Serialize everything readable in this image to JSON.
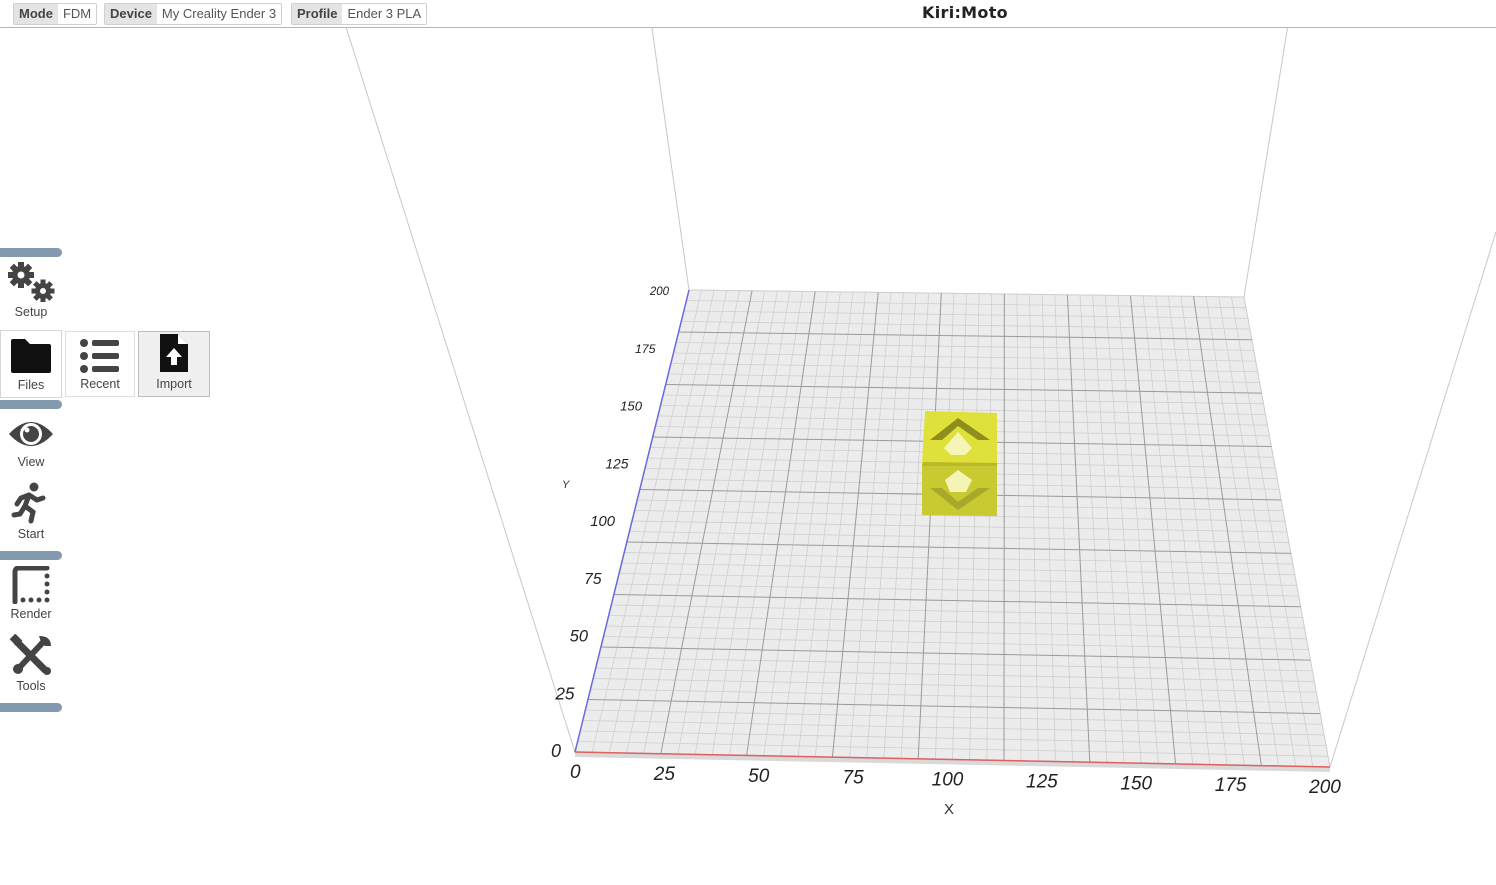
{
  "topbar": {
    "mode_key": "Mode",
    "mode_val": "FDM",
    "device_key": "Device",
    "device_val": "My Creality Ender 3",
    "profile_key": "Profile",
    "profile_val": "Ender 3 PLA",
    "title": "Kiri:Moto"
  },
  "sidebar": {
    "setup": "Setup",
    "files": "Files",
    "recent": "Recent",
    "import": "Import",
    "view": "View",
    "start": "Start",
    "render": "Render",
    "tools": "Tools"
  },
  "bed": {
    "x_label": "X",
    "y_label": "Y",
    "x_ticks": [
      "0",
      "25",
      "50",
      "75",
      "100",
      "125",
      "150",
      "175",
      "200"
    ],
    "y_ticks": [
      "0",
      "25",
      "50",
      "75",
      "100",
      "125",
      "150",
      "175",
      "200"
    ]
  },
  "colors": {
    "sep": "#8399ad",
    "model": "#dede2c",
    "x_axis": "#e06060",
    "y_axis": "#6a6ae0"
  }
}
